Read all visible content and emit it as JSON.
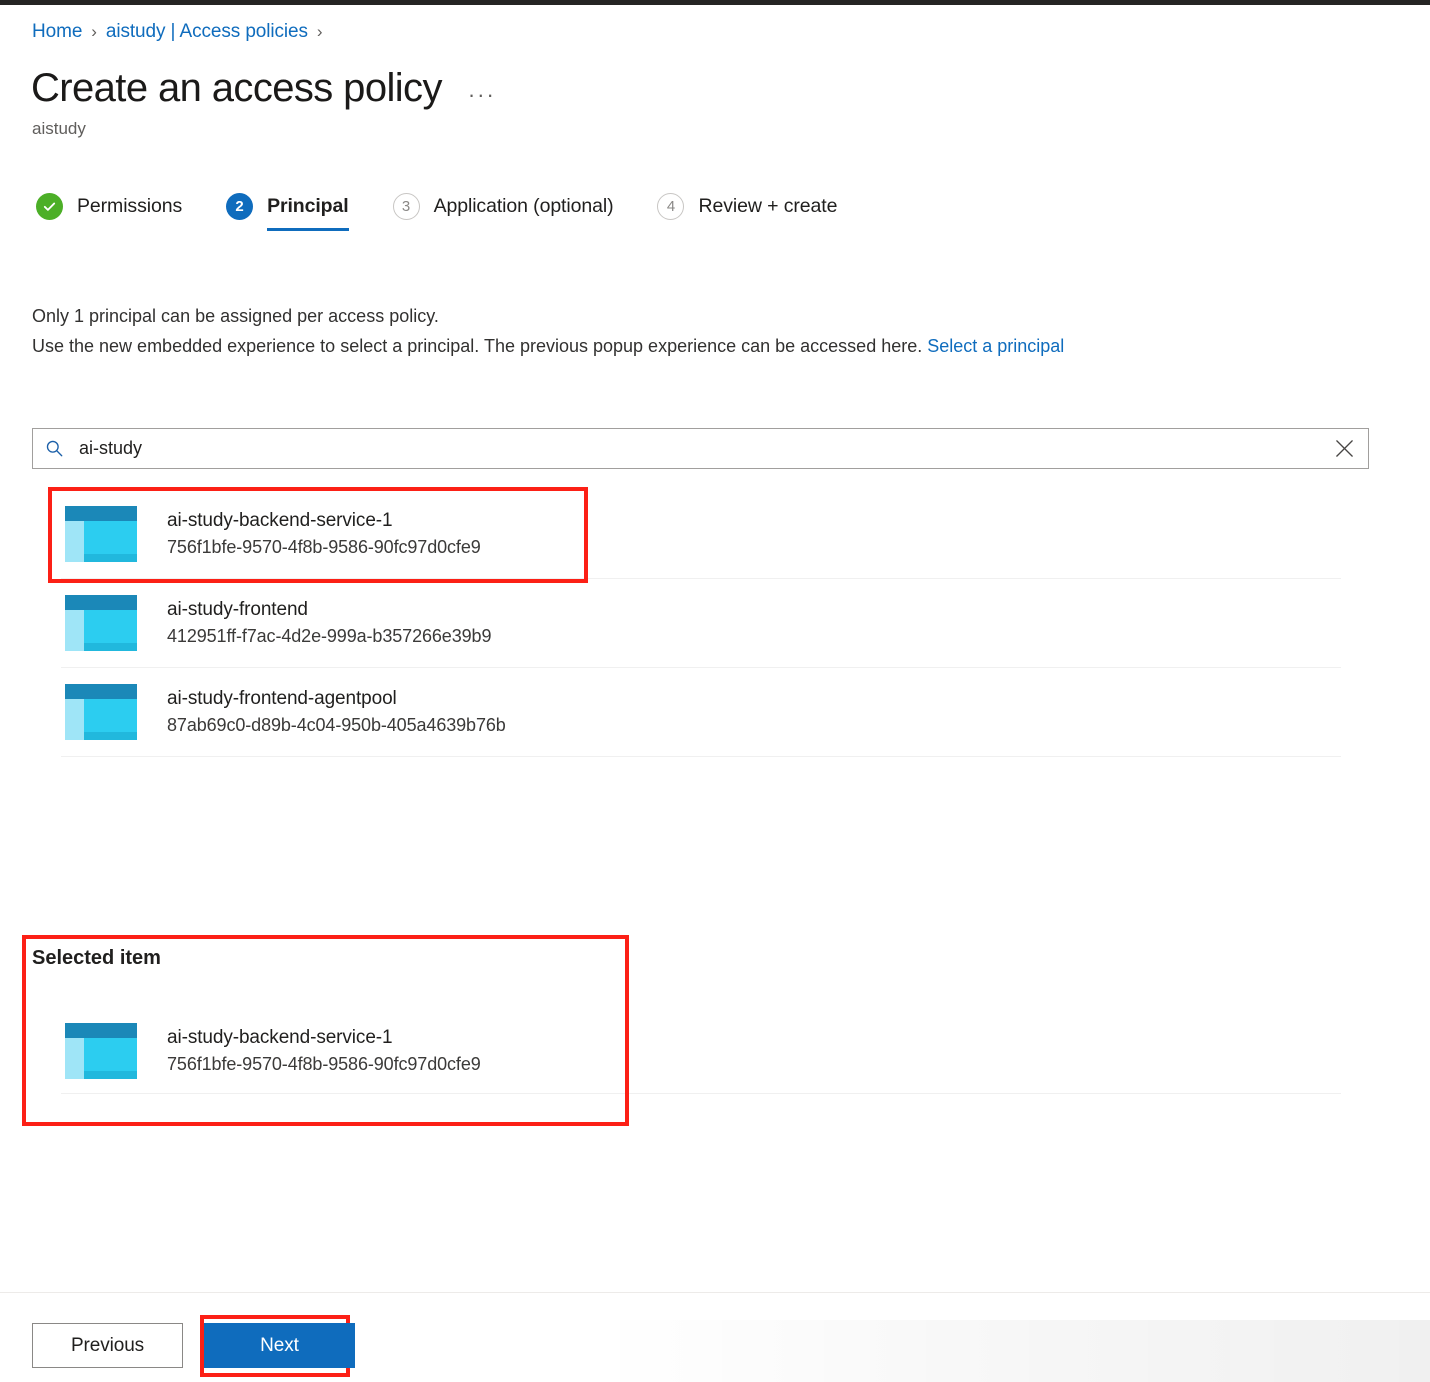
{
  "breadcrumb": {
    "items": [
      "Home",
      "aistudy | Access policies"
    ],
    "separator": "›"
  },
  "header": {
    "title": "Create an access policy",
    "subtitle": "aistudy",
    "more_label": "···"
  },
  "wizard": {
    "tabs": [
      {
        "marker": "✓",
        "label": "Permissions",
        "state": "done"
      },
      {
        "marker": "2",
        "label": "Principal",
        "state": "active"
      },
      {
        "marker": "3",
        "label": "Application (optional)",
        "state": "idle"
      },
      {
        "marker": "4",
        "label": "Review + create",
        "state": "idle"
      }
    ]
  },
  "description": {
    "line1": "Only 1 principal can be assigned per access policy.",
    "line2_prefix": "Use the new embedded experience to select a principal. The previous popup experience can be accessed here. ",
    "line2_link": "Select a principal"
  },
  "search": {
    "value": "ai-study",
    "placeholder": "Search",
    "icon": "search-icon",
    "clear_icon": "close-icon"
  },
  "results": [
    {
      "name": "ai-study-backend-service-1",
      "id": "756f1bfe-9570-4f8b-9586-90fc97d0cfe9",
      "icon": "app-registration-icon"
    },
    {
      "name": "ai-study-frontend",
      "id": "412951ff-f7ac-4d2e-999a-b357266e39b9",
      "icon": "app-registration-icon"
    },
    {
      "name": "ai-study-frontend-agentpool",
      "id": "87ab69c0-d89b-4c04-950b-405a4639b76b",
      "icon": "app-registration-icon"
    }
  ],
  "selected": {
    "heading": "Selected item",
    "items": [
      {
        "name": "ai-study-backend-service-1",
        "id": "756f1bfe-9570-4f8b-9586-90fc97d0cfe9",
        "icon": "app-registration-icon"
      }
    ]
  },
  "footer": {
    "previous_label": "Previous",
    "next_label": "Next"
  },
  "colors": {
    "accent_blue": "#0f6cbd",
    "link_blue": "#0f6cbd",
    "done_green": "#4caf27",
    "highlight_red": "#fc2016",
    "icon_dark_blue": "#1b88b8",
    "icon_cyan": "#2ccdf0",
    "icon_light_cyan": "#9fe5f7"
  }
}
